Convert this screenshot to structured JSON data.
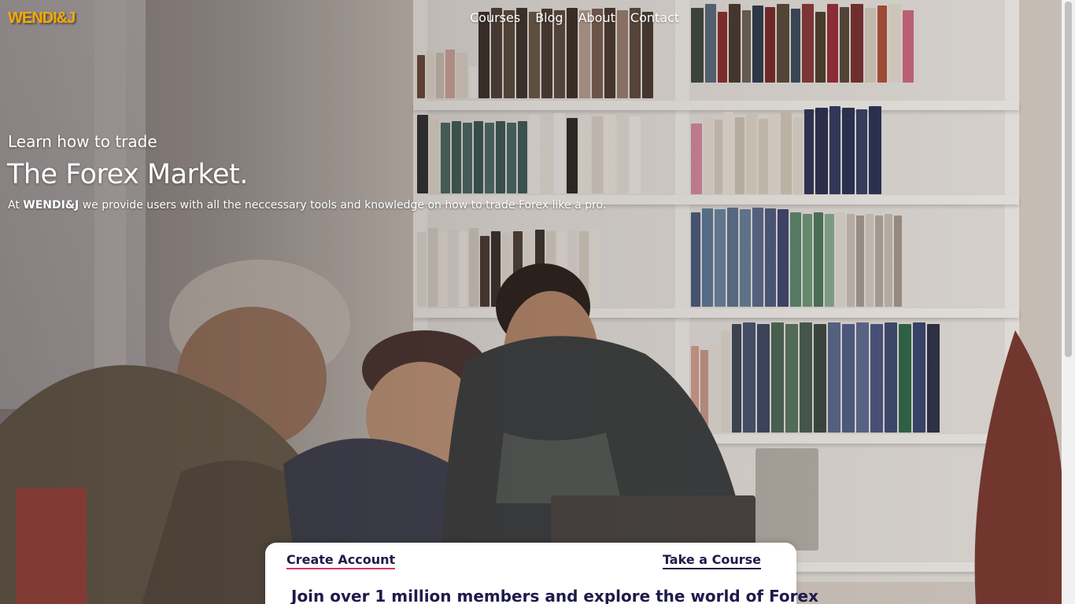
{
  "header": {
    "logo_text": "WENDI&J",
    "nav": [
      {
        "label": "Courses"
      },
      {
        "label": "Blog"
      },
      {
        "label": "About"
      },
      {
        "label": "Contact"
      }
    ]
  },
  "hero": {
    "subtitle": "Learn how to trade",
    "title": "The Forex Market.",
    "description_prefix": "At ",
    "description_brand": "WENDI&J",
    "description_suffix": " we provide users with all the neccessary tools and knowledge on how to trade Forex like a pro."
  },
  "card": {
    "create_account_label": "Create Account",
    "take_course_label": "Take a Course",
    "heading": "Join over 1 million members and explore the world of Forex"
  },
  "colors": {
    "logo": "#f2a900",
    "card_text": "#1e1b4b",
    "accent_underline": "#d6336c"
  }
}
